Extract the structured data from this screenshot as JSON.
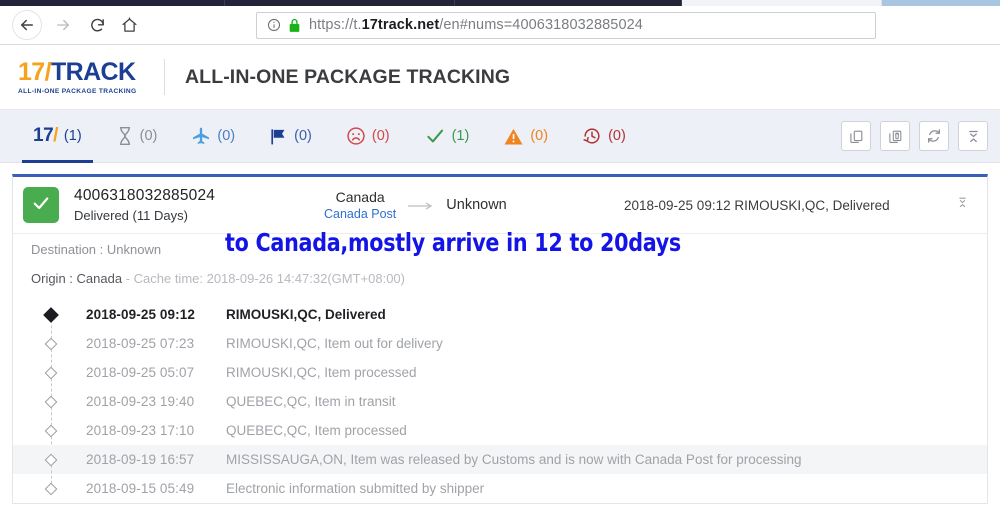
{
  "browser": {
    "back_icon": "back-arrow-icon",
    "forward_icon": "forward-arrow-icon",
    "reload_icon": "reload-icon",
    "home_icon": "home-icon",
    "url_prefix": "https://t.",
    "url_domain": "17track.net",
    "url_suffix": "/en#nums=4006318032885024",
    "info_icon": "info-circle-icon",
    "lock_icon": "lock-icon"
  },
  "site_header": {
    "logo_17": "17",
    "logo_slash": "/",
    "logo_track": "TRACK",
    "logo_sub": "ALL-IN-ONE PACKAGE TRACKING",
    "tagline": "ALL-IN-ONE PACKAGE TRACKING"
  },
  "status_tabs": [
    {
      "icon": "17track-logo-icon",
      "label": "17",
      "count": "(1)",
      "color": "#1c3f94",
      "active": true
    },
    {
      "icon": "hourglass-icon",
      "label": "",
      "count": "(0)",
      "color": "#8b8e94",
      "active": false
    },
    {
      "icon": "airplane-icon",
      "label": "",
      "count": "(0)",
      "color": "#4a9fe0",
      "active": false
    },
    {
      "icon": "flag-icon",
      "label": "",
      "count": "(0)",
      "color": "#1c3f94",
      "active": false
    },
    {
      "icon": "sad-face-icon",
      "label": "",
      "count": "(0)",
      "color": "#cf4a4a",
      "active": false
    },
    {
      "icon": "check-icon",
      "label": "",
      "count": "(1)",
      "color": "#3a9a4a",
      "active": false
    },
    {
      "icon": "warning-triangle-icon",
      "label": "",
      "count": "(0)",
      "color": "#ef8421",
      "active": false
    },
    {
      "icon": "clock-history-icon",
      "label": "",
      "count": "(0)",
      "color": "#b03434",
      "active": false
    }
  ],
  "toolbar_buttons": [
    {
      "name": "copy-button",
      "icon": "copy-icon"
    },
    {
      "name": "copy-delete-button",
      "icon": "copy-delete-icon"
    },
    {
      "name": "refresh-button",
      "icon": "refresh-icon"
    },
    {
      "name": "collapse-all-button",
      "icon": "collapse-all-icon"
    }
  ],
  "result": {
    "status_icon": "check-icon",
    "tracking_number": "4006318032885024",
    "status_text": "Delivered (11 Days)",
    "origin_country": "Canada",
    "carrier": "Canada Post",
    "arrow_icon": "arrow-right-icon",
    "destination_country": "Unknown",
    "latest_event": "2018-09-25 09:12  RIMOUSKI,QC, Delivered",
    "collapse_icon": "collapse-icon",
    "destination_label": "Destination : Unknown",
    "origin_label": "Origin : Canada",
    "cache_time": "- Cache time: 2018-09-26 14:47:32(GMT+08:00)",
    "annotation": "to Canada,mostly arrive in 12 to 20days"
  },
  "timeline": [
    {
      "date": "2018-09-25 09:12",
      "desc": "RIMOUSKI,QC, Delivered",
      "highlight": false
    },
    {
      "date": "2018-09-25 07:23",
      "desc": "RIMOUSKI,QC, Item out for delivery",
      "highlight": false
    },
    {
      "date": "2018-09-25 05:07",
      "desc": "RIMOUSKI,QC, Item processed",
      "highlight": false
    },
    {
      "date": "2018-09-23 19:40",
      "desc": "QUEBEC,QC, Item in transit",
      "highlight": false
    },
    {
      "date": "2018-09-23 17:10",
      "desc": "QUEBEC,QC, Item processed",
      "highlight": false
    },
    {
      "date": "2018-09-19 16:57",
      "desc": "MISSISSAUGA,ON, Item was released by Customs and is now with Canada Post for processing",
      "highlight": true
    },
    {
      "date": "2018-09-15 05:49",
      "desc": "Electronic information submitted by shipper",
      "highlight": false
    }
  ]
}
